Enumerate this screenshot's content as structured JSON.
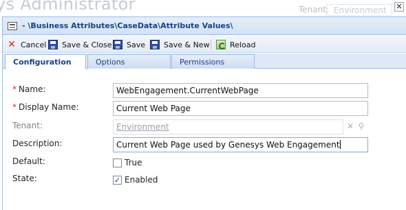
{
  "background": {
    "app_title": "ys Administrator",
    "tenant_label": "Tenant:",
    "tenant_value": "Environment"
  },
  "window": {
    "close_glyph": "✕",
    "breadcrumb": "- \\Business Attributes\\CaseData\\Attribute Values\\"
  },
  "toolbar": {
    "cancel": "Cancel",
    "save_close": "Save & Close",
    "save": "Save",
    "save_new": "Save & New",
    "reload": "Reload"
  },
  "tabs": [
    {
      "label": "Configuration",
      "active": true
    },
    {
      "label": "Options",
      "active": false
    },
    {
      "label": "Permissions",
      "active": false
    }
  ],
  "form": {
    "name": {
      "label": "Name:",
      "required": true,
      "value": "WebEngagement.CurrentWebPage"
    },
    "display_name": {
      "label": "Display Name:",
      "required": true,
      "value": "Current Web Page"
    },
    "tenant": {
      "label": "Tenant:",
      "value": "Environment",
      "disabled": true
    },
    "description": {
      "label": "Description:",
      "value": "Current Web Page used by Genesys Web Engagement"
    },
    "default": {
      "label": "Default:",
      "checkbox_label": "True",
      "checked": false
    },
    "state": {
      "label": "State:",
      "checkbox_label": "Enabled",
      "checked": true
    }
  },
  "required_marker": "*",
  "icons": {
    "cancel": "cancel-x-icon",
    "save_close": "disk-icon",
    "save": "disk-icon",
    "save_new": "disk-plus-icon",
    "reload": "reload-icon",
    "clear": "clear-x-icon",
    "search": "search-icon",
    "check": "✓"
  },
  "colors": {
    "header_title": "#15428b",
    "required": "#d42a1a",
    "border": "#99bbe8"
  }
}
